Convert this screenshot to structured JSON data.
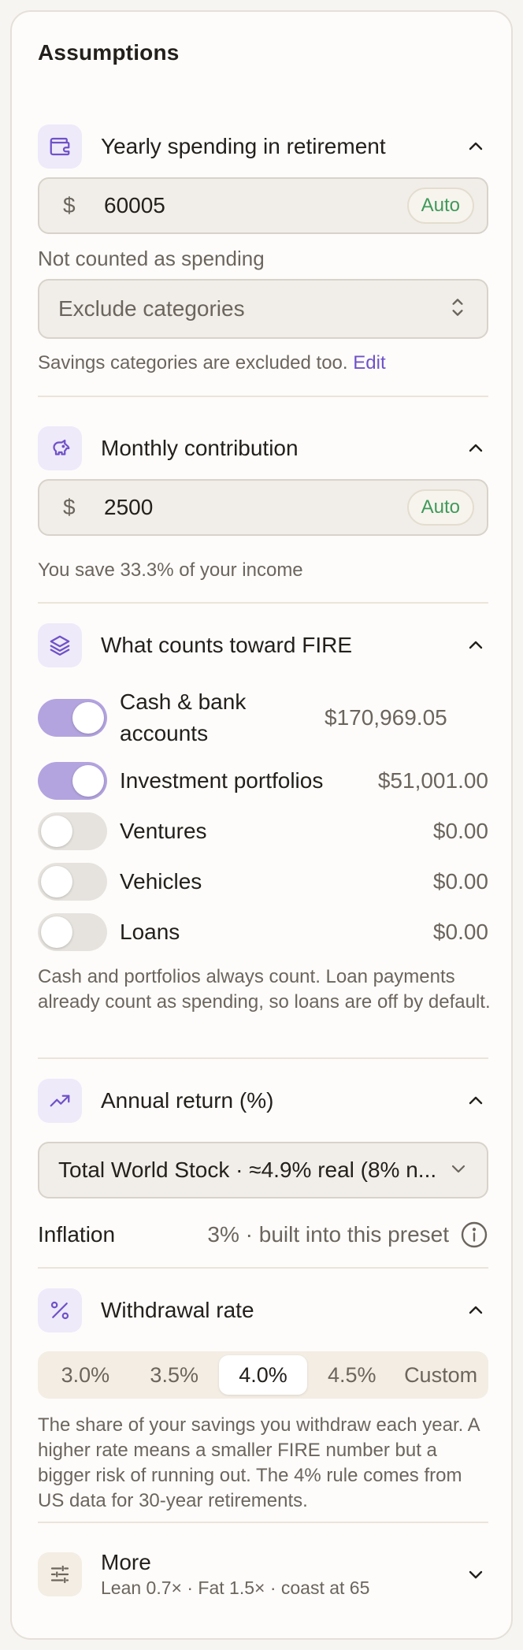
{
  "title": "Assumptions",
  "spending": {
    "title": "Yearly spending in retirement",
    "currency": "$",
    "value": "60005",
    "auto_label": "Auto",
    "exclude_label": "Not counted as spending",
    "exclude_placeholder": "Exclude categories",
    "note": "Savings categories are excluded too.",
    "edit_link": "Edit"
  },
  "contribution": {
    "title": "Monthly contribution",
    "currency": "$",
    "value": "2500",
    "auto_label": "Auto",
    "note": "You save 33.3% of your income"
  },
  "fire": {
    "title": "What counts toward FIRE",
    "items": [
      {
        "label": "Cash & bank accounts",
        "value": "$170,969.05",
        "on": true
      },
      {
        "label": "Investment portfolios",
        "value": "$51,001.00",
        "on": true
      },
      {
        "label": "Ventures",
        "value": "$0.00",
        "on": false
      },
      {
        "label": "Vehicles",
        "value": "$0.00",
        "on": false
      },
      {
        "label": "Loans",
        "value": "$0.00",
        "on": false
      }
    ],
    "note": "Cash and portfolios always count. Loan payments already count as spending, so loans are off by default."
  },
  "annual_return": {
    "title": "Annual return (%)",
    "selected": "Total World Stock · ≈4.9% real (8% n...",
    "inflation_label": "Inflation",
    "inflation_value": "3% · built into this preset"
  },
  "withdrawal": {
    "title": "Withdrawal rate",
    "options": [
      "3.0%",
      "3.5%",
      "4.0%",
      "4.5%",
      "Custom"
    ],
    "selected_index": 2,
    "note": "The share of your savings you withdraw each year. A higher rate means a smaller FIRE number but a bigger risk of running out. The 4% rule comes from US data for 30-year retirements."
  },
  "more": {
    "title": "More",
    "subtitle": "Lean 0.7× · Fat 1.5× · coast at 65"
  },
  "colors": {
    "accent": "#6f52c8",
    "toggle_on": "#b3a4e0",
    "auto_green": "#3f9a5a",
    "icon_bg": "#eeeafa"
  }
}
